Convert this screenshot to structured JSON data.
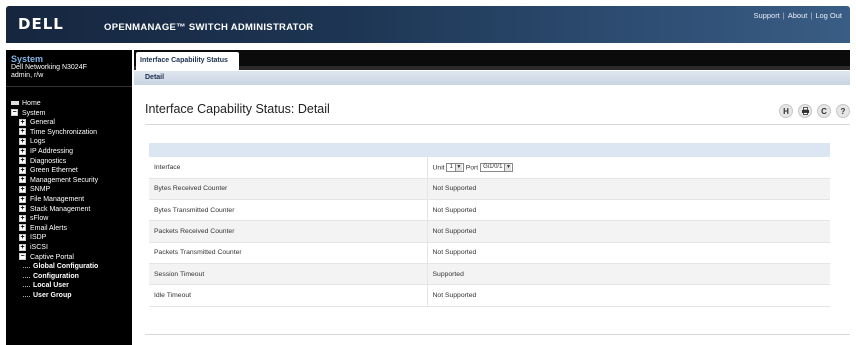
{
  "header": {
    "logo": "DELL",
    "product": "OPENMANAGE™ SWITCH ADMINISTRATOR",
    "links": [
      "Support",
      "About",
      "Log Out"
    ]
  },
  "sidebar": {
    "system_title": "System",
    "device": "Dell Networking N3024F",
    "user": "admin, r/w",
    "home": "Home",
    "root": "System",
    "items": [
      "General",
      "Time Synchronization",
      "Logs",
      "IP Addressing",
      "Diagnostics",
      "Green Ethernet",
      "Management Security",
      "SNMP",
      "File Management",
      "Stack Management",
      "sFlow",
      "Email Alerts",
      "ISDP",
      "iSCSI",
      "Captive Portal"
    ],
    "subitems": [
      "Global Configuratio",
      "Configuration",
      "Local User",
      "User Group"
    ]
  },
  "tabs": {
    "active": "Interface Capability Status",
    "subtab": "Detail"
  },
  "page": {
    "title": "Interface Capability Status: Detail"
  },
  "toolbar_icons": [
    "H",
    "print-icon",
    "C",
    "?"
  ],
  "form": {
    "interface_label": "Interface",
    "unit_label": "Unit",
    "unit_value": "1",
    "port_label": "Port",
    "port_value": "Gi1/0/1",
    "rows": [
      {
        "label": "Bytes Received Counter",
        "value": "Not Supported"
      },
      {
        "label": "Bytes Transmitted Counter",
        "value": "Not Supported"
      },
      {
        "label": "Packets Received Counter",
        "value": "Not Supported"
      },
      {
        "label": "Packets Transmitted Counter",
        "value": "Not Supported"
      },
      {
        "label": "Session Timeout",
        "value": "Supported"
      },
      {
        "label": "Idle Timeout",
        "value": "Not Supported"
      }
    ]
  }
}
